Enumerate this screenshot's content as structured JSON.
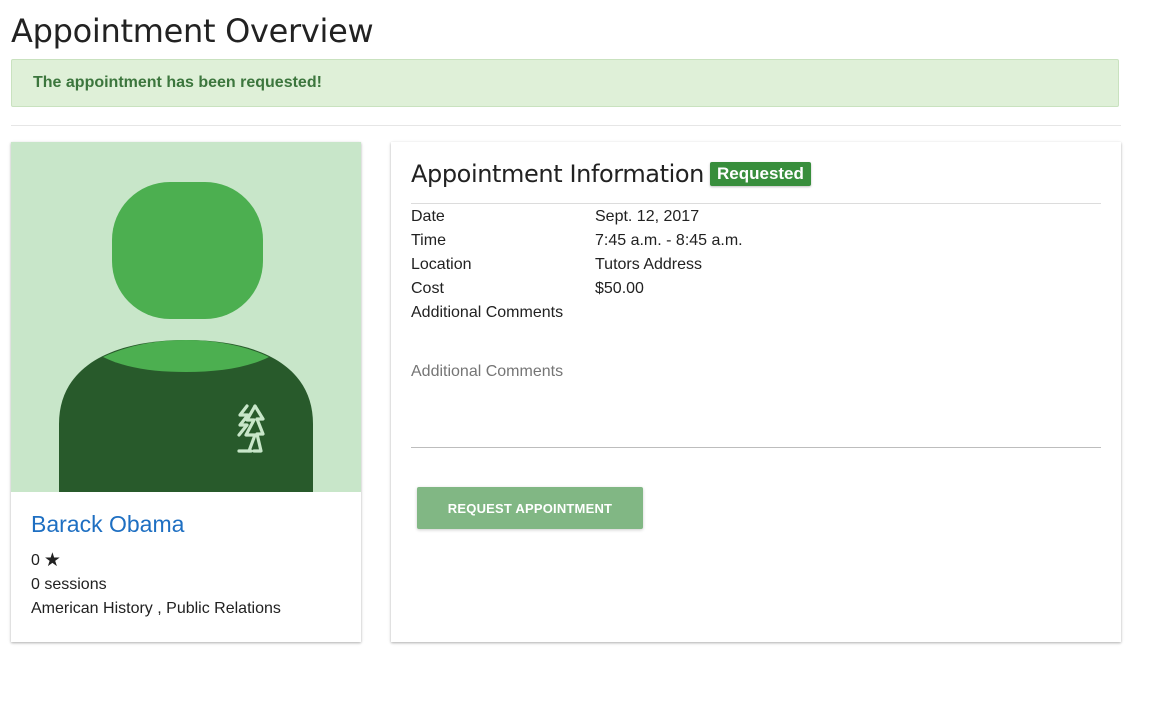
{
  "page": {
    "title": "Appointment Overview"
  },
  "alert": {
    "message": "The appointment has been requested!"
  },
  "tutor": {
    "name": "Barack Obama",
    "rating": "0",
    "sessions": "0 sessions",
    "subjects": "American History , Public Relations",
    "avatar_icon": "person-silhouette-icon"
  },
  "appointment": {
    "title": "Appointment Information",
    "status": "Requested",
    "details": [
      {
        "label": "Date",
        "value": "Sept. 12, 2017"
      },
      {
        "label": "Time",
        "value": "7:45 a.m. - 8:45 a.m."
      },
      {
        "label": "Location",
        "value": "Tutors Address"
      },
      {
        "label": "Cost",
        "value": "$50.00"
      },
      {
        "label": "Additional Comments",
        "value": ""
      }
    ],
    "comments_placeholder": "Additional Comments",
    "comments_value": "",
    "request_button_label": "REQUEST APPOINTMENT"
  },
  "colors": {
    "alert_bg": "#dff0d8",
    "alert_text": "#3c763d",
    "badge": "#388e3c",
    "button": "#81b784",
    "link": "#1e6fc2",
    "avatar_bg": "#c8e6c9",
    "avatar_head": "#4caf50",
    "avatar_body": "#285a2b"
  }
}
